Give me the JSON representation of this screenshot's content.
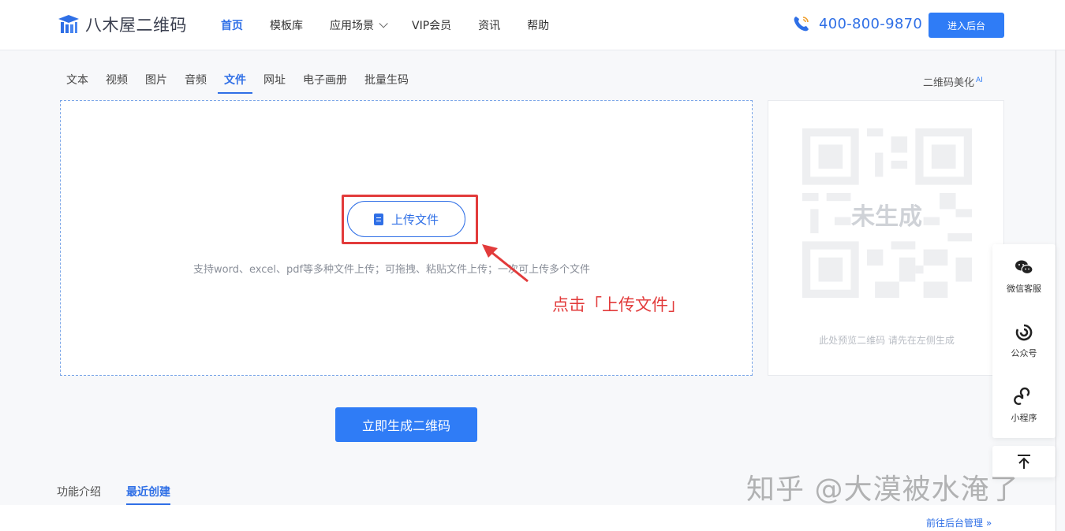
{
  "header": {
    "logo_text": "八木屋二维码",
    "nav": [
      {
        "label": "首页",
        "active": true
      },
      {
        "label": "模板库"
      },
      {
        "label": "应用场景",
        "dropdown": true
      },
      {
        "label": "VIP会员"
      },
      {
        "label": "资讯"
      },
      {
        "label": "帮助"
      }
    ],
    "phone": "400-800-9870",
    "admin_button": "进入后台"
  },
  "tabs": [
    "文本",
    "视频",
    "图片",
    "音频",
    "文件",
    "网址",
    "电子画册",
    "批量生码"
  ],
  "active_tab": "文件",
  "beautify": {
    "label": "二维码美化",
    "badge": "AI"
  },
  "upload": {
    "button_label": "上传文件",
    "hint": "支持word、excel、pdf等多种文件上传；可拖拽、粘贴文件上传；一次可上传多个文件"
  },
  "annotation": "点击「上传文件」",
  "qr_preview": {
    "status": "未生成",
    "tip": "此处预览二维码 请先在左侧生成"
  },
  "float_bar": {
    "wechat": "微信客服",
    "official": "公众号",
    "mini": "小程序"
  },
  "generate_button": "立即生成二维码",
  "bottom_tabs": [
    "功能介绍",
    "最近创建"
  ],
  "bottom_active": "最近创建",
  "manage_link": "前往后台管理 »",
  "watermark": "知乎 @大漠被水淹了",
  "colors": {
    "primary": "#2f7cf6",
    "accent_red": "#e23b3b"
  }
}
